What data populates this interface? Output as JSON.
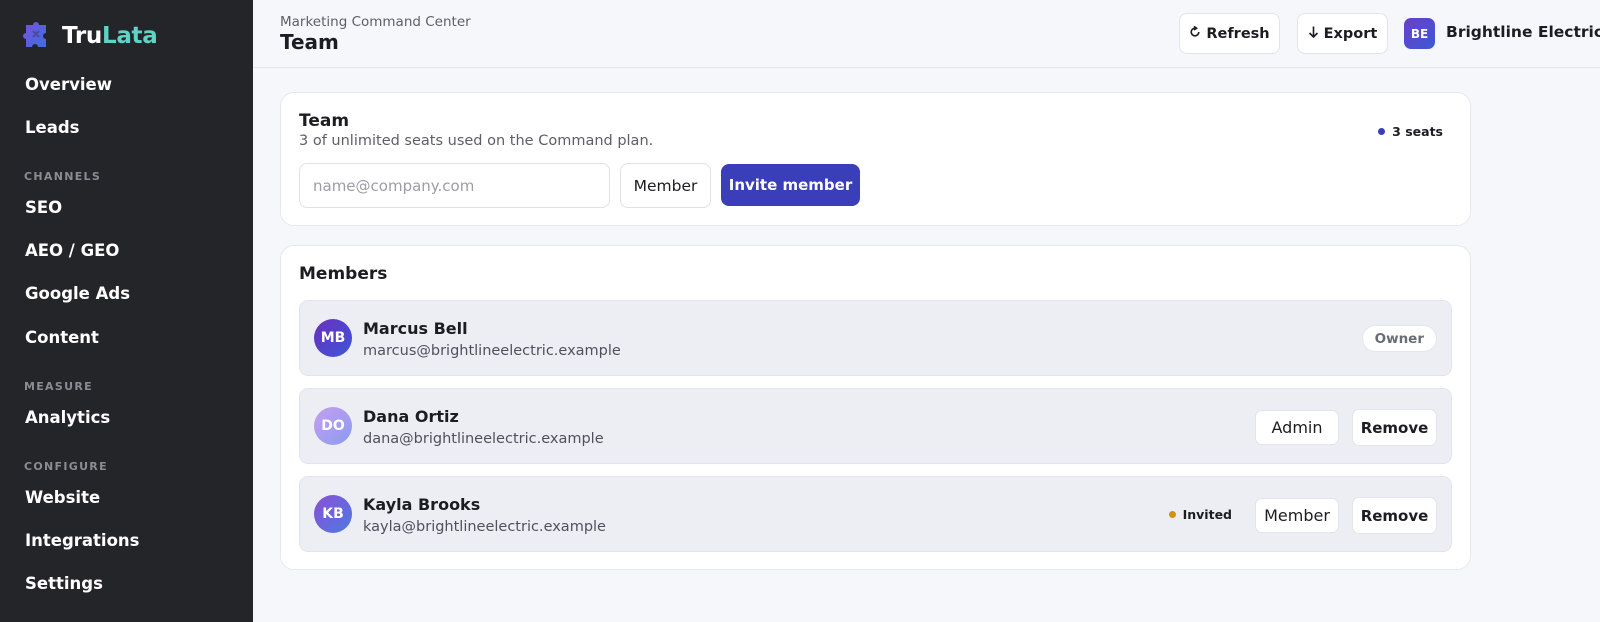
{
  "brand": {
    "name_part1": "Tru",
    "name_part2": "Lata",
    "accent_color": "#5fd3c4",
    "logo_icon": "puzzle-icon"
  },
  "sidebar": {
    "items": [
      {
        "label": "Overview"
      },
      {
        "label": "Leads"
      },
      {
        "section": "CHANNELS"
      },
      {
        "label": "SEO"
      },
      {
        "label": "AEO / GEO"
      },
      {
        "label": "Google Ads"
      },
      {
        "label": "Content"
      },
      {
        "section": "MEASURE"
      },
      {
        "label": "Analytics"
      },
      {
        "section": "CONFIGURE"
      },
      {
        "label": "Website"
      },
      {
        "label": "Integrations"
      },
      {
        "label": "Settings"
      }
    ]
  },
  "header": {
    "breadcrumb": "Marketing Command Center",
    "title": "Team",
    "refresh_label": "Refresh",
    "refresh_icon": "refresh-icon",
    "export_label": "Export",
    "export_icon": "arrow-down-icon",
    "org_initials": "BE",
    "org_name": "Brightline Electric"
  },
  "team_card": {
    "title": "Team",
    "subtitle": "3 of unlimited seats used on the Command plan.",
    "seats_label": "3 seats",
    "seats_dot_color": "#3a3eb8",
    "email_placeholder": "name@company.com",
    "role_value": "Member",
    "invite_label": "Invite member",
    "primary_color": "#3a3eb8"
  },
  "members_card": {
    "title": "Members",
    "members": [
      {
        "initials": "MB",
        "name": "Marcus Bell",
        "email": "marcus@brightlineelectric.example",
        "badge": "Owner"
      },
      {
        "initials": "DO",
        "name": "Dana Ortiz",
        "email": "dana@brightlineelectric.example",
        "role": "Admin",
        "remove_label": "Remove"
      },
      {
        "initials": "KB",
        "name": "Kayla Brooks",
        "email": "kayla@brightlineelectric.example",
        "status": "Invited",
        "status_color": "#d4900f",
        "role": "Member",
        "remove_label": "Remove"
      }
    ]
  }
}
